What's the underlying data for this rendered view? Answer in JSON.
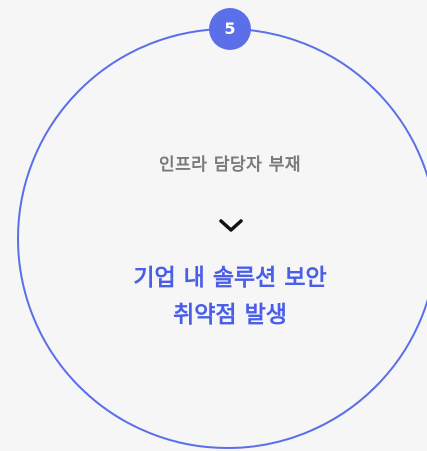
{
  "step": {
    "number": "5",
    "accent_color": "#5b6fe8"
  },
  "card": {
    "subtitle": "인프라 담당자 부재",
    "arrow_icon": "chevron-down-icon",
    "headline_line1": "기업 내 솔루션 보안",
    "headline_line2": "취약점 발생"
  }
}
